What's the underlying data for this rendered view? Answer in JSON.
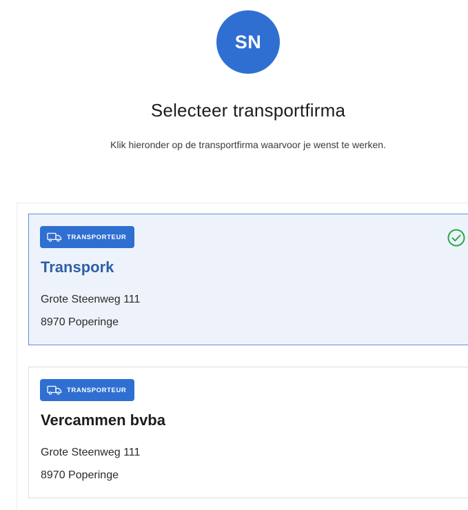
{
  "user": {
    "initials": "SN"
  },
  "header": {
    "title": "Selecteer transportfirma",
    "subtitle": "Klik hieronder op de transportfirma waarvoor je wenst te werken."
  },
  "companies": [
    {
      "badge": "TRANSPORTEUR",
      "name": "Transpork",
      "street": "Grote Steenweg 111",
      "city": "8970 Poperinge",
      "selected": true
    },
    {
      "badge": "TRANSPORTEUR",
      "name": "Vercammen bvba",
      "street": "Grote Steenweg 111",
      "city": "8970 Poperinge",
      "selected": false
    }
  ],
  "colors": {
    "accent": "#2f6fd2",
    "selected_background": "#eef3fb",
    "selected_border": "#5b8fd9",
    "check": "#27a844"
  },
  "icons": {
    "badge_icon": "truck-icon",
    "selected_icon": "check-circle-icon"
  }
}
